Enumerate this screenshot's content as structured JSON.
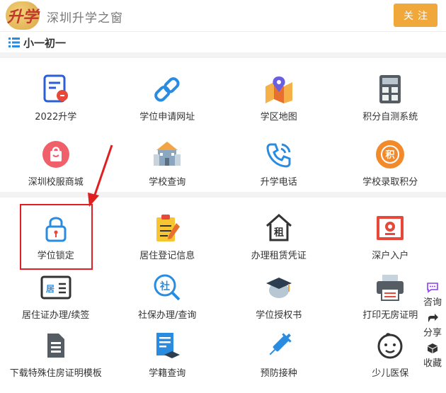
{
  "header": {
    "logo_text": "升学",
    "site_title": "深圳升学之窗",
    "follow_button": "关注"
  },
  "section": {
    "title": "小一初一"
  },
  "grid_top": [
    {
      "label": "2022升学",
      "icon": "document-icon"
    },
    {
      "label": "学位申请网址",
      "icon": "link-icon"
    },
    {
      "label": "学区地图",
      "icon": "map-pin-icon"
    },
    {
      "label": "积分自测系统",
      "icon": "calculator-icon"
    },
    {
      "label": "深圳校服商城",
      "icon": "shopping-bag-icon"
    },
    {
      "label": "学校查询",
      "icon": "school-building-icon"
    },
    {
      "label": "升学电话",
      "icon": "phone-icon"
    },
    {
      "label": "学校录取积分",
      "icon": "points-badge-icon"
    }
  ],
  "grid_bottom": [
    {
      "label": "学位锁定",
      "icon": "lock-icon"
    },
    {
      "label": "居住登记信息",
      "icon": "clipboard-pencil-icon"
    },
    {
      "label": "办理租赁凭证",
      "icon": "rent-house-icon"
    },
    {
      "label": "深户入户",
      "icon": "certificate-icon"
    },
    {
      "label": "居住证办理/续签",
      "icon": "residence-card-icon"
    },
    {
      "label": "社保办理/查询",
      "icon": "social-security-search-icon"
    },
    {
      "label": "学位授权书",
      "icon": "graduation-cap-icon"
    },
    {
      "label": "打印无房证明",
      "icon": "printer-icon"
    },
    {
      "label": "下载特殊住房证明模板",
      "icon": "file-template-icon"
    },
    {
      "label": "学籍查询",
      "icon": "student-record-icon"
    },
    {
      "label": "预防接种",
      "icon": "vaccine-icon"
    },
    {
      "label": "少儿医保",
      "icon": "child-face-icon"
    }
  ],
  "badge_char_rent": "租",
  "badge_char_residence": "居",
  "badge_char_social": "社",
  "badge_char_points": "积",
  "float_bar": [
    {
      "label": "咨询",
      "icon": "chat-icon"
    },
    {
      "label": "分享",
      "icon": "share-icon"
    },
    {
      "label": "收藏",
      "icon": "cube-icon"
    }
  ],
  "colors": {
    "accent": "#f0a83a",
    "blue": "#2a8ce0",
    "orange": "#f28a2c",
    "highlight_red": "#e02020"
  }
}
